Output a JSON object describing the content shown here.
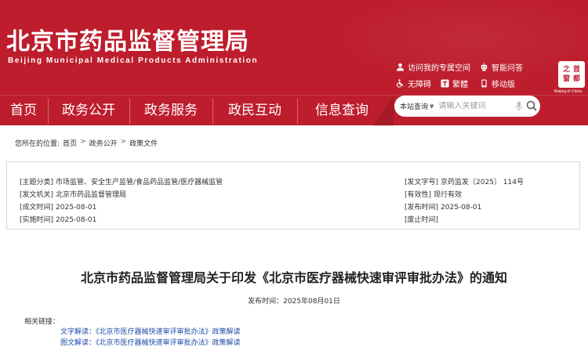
{
  "header": {
    "title": "北京市药品监督管理局",
    "subtitle": "Beijing Municipal Medical Products Administration",
    "tools": {
      "personal_space": "访问我的专属空间",
      "smart_qa": "智能问答",
      "accessibility": "无障碍",
      "traditional": "繁體",
      "mobile": "移动版"
    },
    "seal": {
      "glyphs": [
        "之",
        "首",
        "窗",
        "都"
      ],
      "caption": "Beijing of China"
    }
  },
  "nav": {
    "items": [
      "首页",
      "政务公开",
      "政务服务",
      "政民互动",
      "信息查询"
    ]
  },
  "search": {
    "scope": "本站查询",
    "placeholder": "请输入关键词"
  },
  "breadcrumb": {
    "prefix": "您所在的位置:",
    "items": [
      "首页",
      "政务公开",
      "政策文件"
    ],
    "separator": ">"
  },
  "info": {
    "topic_label": "[主题分类]",
    "topic_value": "市场监管、安全生产监管/食品药品监管/医疗器械监管",
    "issuer_label": "[发文机关]",
    "issuer_value": "北京市药品监督管理局",
    "written_label": "[成文时间]",
    "written_value": "2025-08-01",
    "effective_label": "[实施时间]",
    "effective_value": "2025-08-01",
    "docno_label": "[发文字号]",
    "docno_value": "京药监发〔2025〕 114号",
    "validity_label": "[有效性]",
    "validity_value": "现行有效",
    "pubtime_label": "[发布时间]",
    "pubtime_value": "2025-08-01",
    "abolish_label": "[废止时间]",
    "abolish_value": ""
  },
  "article": {
    "title": "北京市药品监督管理局关于印发《北京市医疗器械快速审评审批办法》的通知",
    "publish_line": "发布时间：2025年08月01日",
    "related_label": "相关链接：",
    "related_links": [
      "文字解读：《北京市医疗器械快速审评审批办法》政策解读",
      "图文解读：《北京市医疗器械快速审评审批办法》政策解读"
    ]
  },
  "colors": {
    "brand_red": "#bd1d2d",
    "link_blue": "#1d4aa8"
  }
}
